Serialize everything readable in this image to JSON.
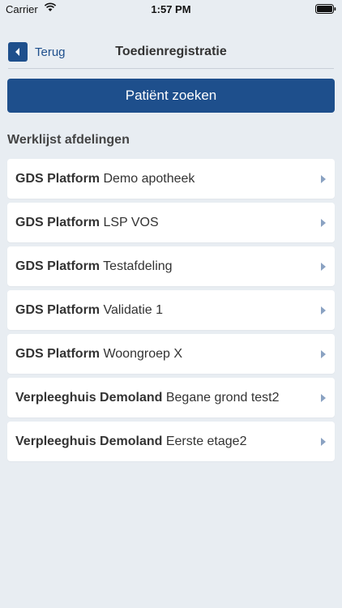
{
  "status_bar": {
    "carrier": "Carrier",
    "time": "1:57 PM"
  },
  "nav": {
    "back_label": "Terug",
    "title": "Toedienregistratie"
  },
  "search_button": "Patiënt zoeken",
  "section_title": "Werklijst afdelingen",
  "items": [
    {
      "org": "GDS Platform",
      "dept": "Demo apotheek"
    },
    {
      "org": "GDS Platform",
      "dept": "LSP VOS"
    },
    {
      "org": "GDS Platform",
      "dept": "Testafdeling"
    },
    {
      "org": "GDS Platform",
      "dept": "Validatie 1"
    },
    {
      "org": "GDS Platform",
      "dept": "Woongroep X"
    },
    {
      "org": "Verpleeghuis Demoland",
      "dept": "Begane grond test2"
    },
    {
      "org": "Verpleeghuis Demoland",
      "dept": "Eerste etage2"
    }
  ],
  "colors": {
    "primary": "#1e4f8c",
    "background": "#e8edf2",
    "chevron": "#8aa2c2"
  }
}
